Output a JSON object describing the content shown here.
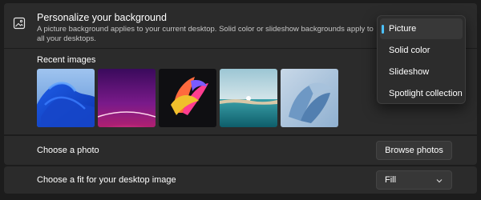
{
  "header": {
    "title": "Personalize your background",
    "description": "A picture background applies to your current desktop. Solid color or slideshow backgrounds apply to all your desktops.",
    "icon": "picture-icon"
  },
  "recent": {
    "label": "Recent images",
    "images": [
      {
        "name": "blue-bloom-wallpaper"
      },
      {
        "name": "purple-glow-wallpaper"
      },
      {
        "name": "colorful-ribbon-wallpaper"
      },
      {
        "name": "lake-sunrise-wallpaper"
      },
      {
        "name": "pale-blue-bloom-wallpaper"
      }
    ]
  },
  "dropdown": {
    "options": [
      "Picture",
      "Solid color",
      "Slideshow",
      "Spotlight collection"
    ],
    "selected": "Picture"
  },
  "photo": {
    "label": "Choose a photo",
    "button": "Browse photos"
  },
  "fit": {
    "label": "Choose a fit for your desktop image",
    "value": "Fill"
  },
  "colors": {
    "background": "#1c1c1c",
    "card": "#2b2b2b",
    "accent": "#4cc2ff"
  }
}
